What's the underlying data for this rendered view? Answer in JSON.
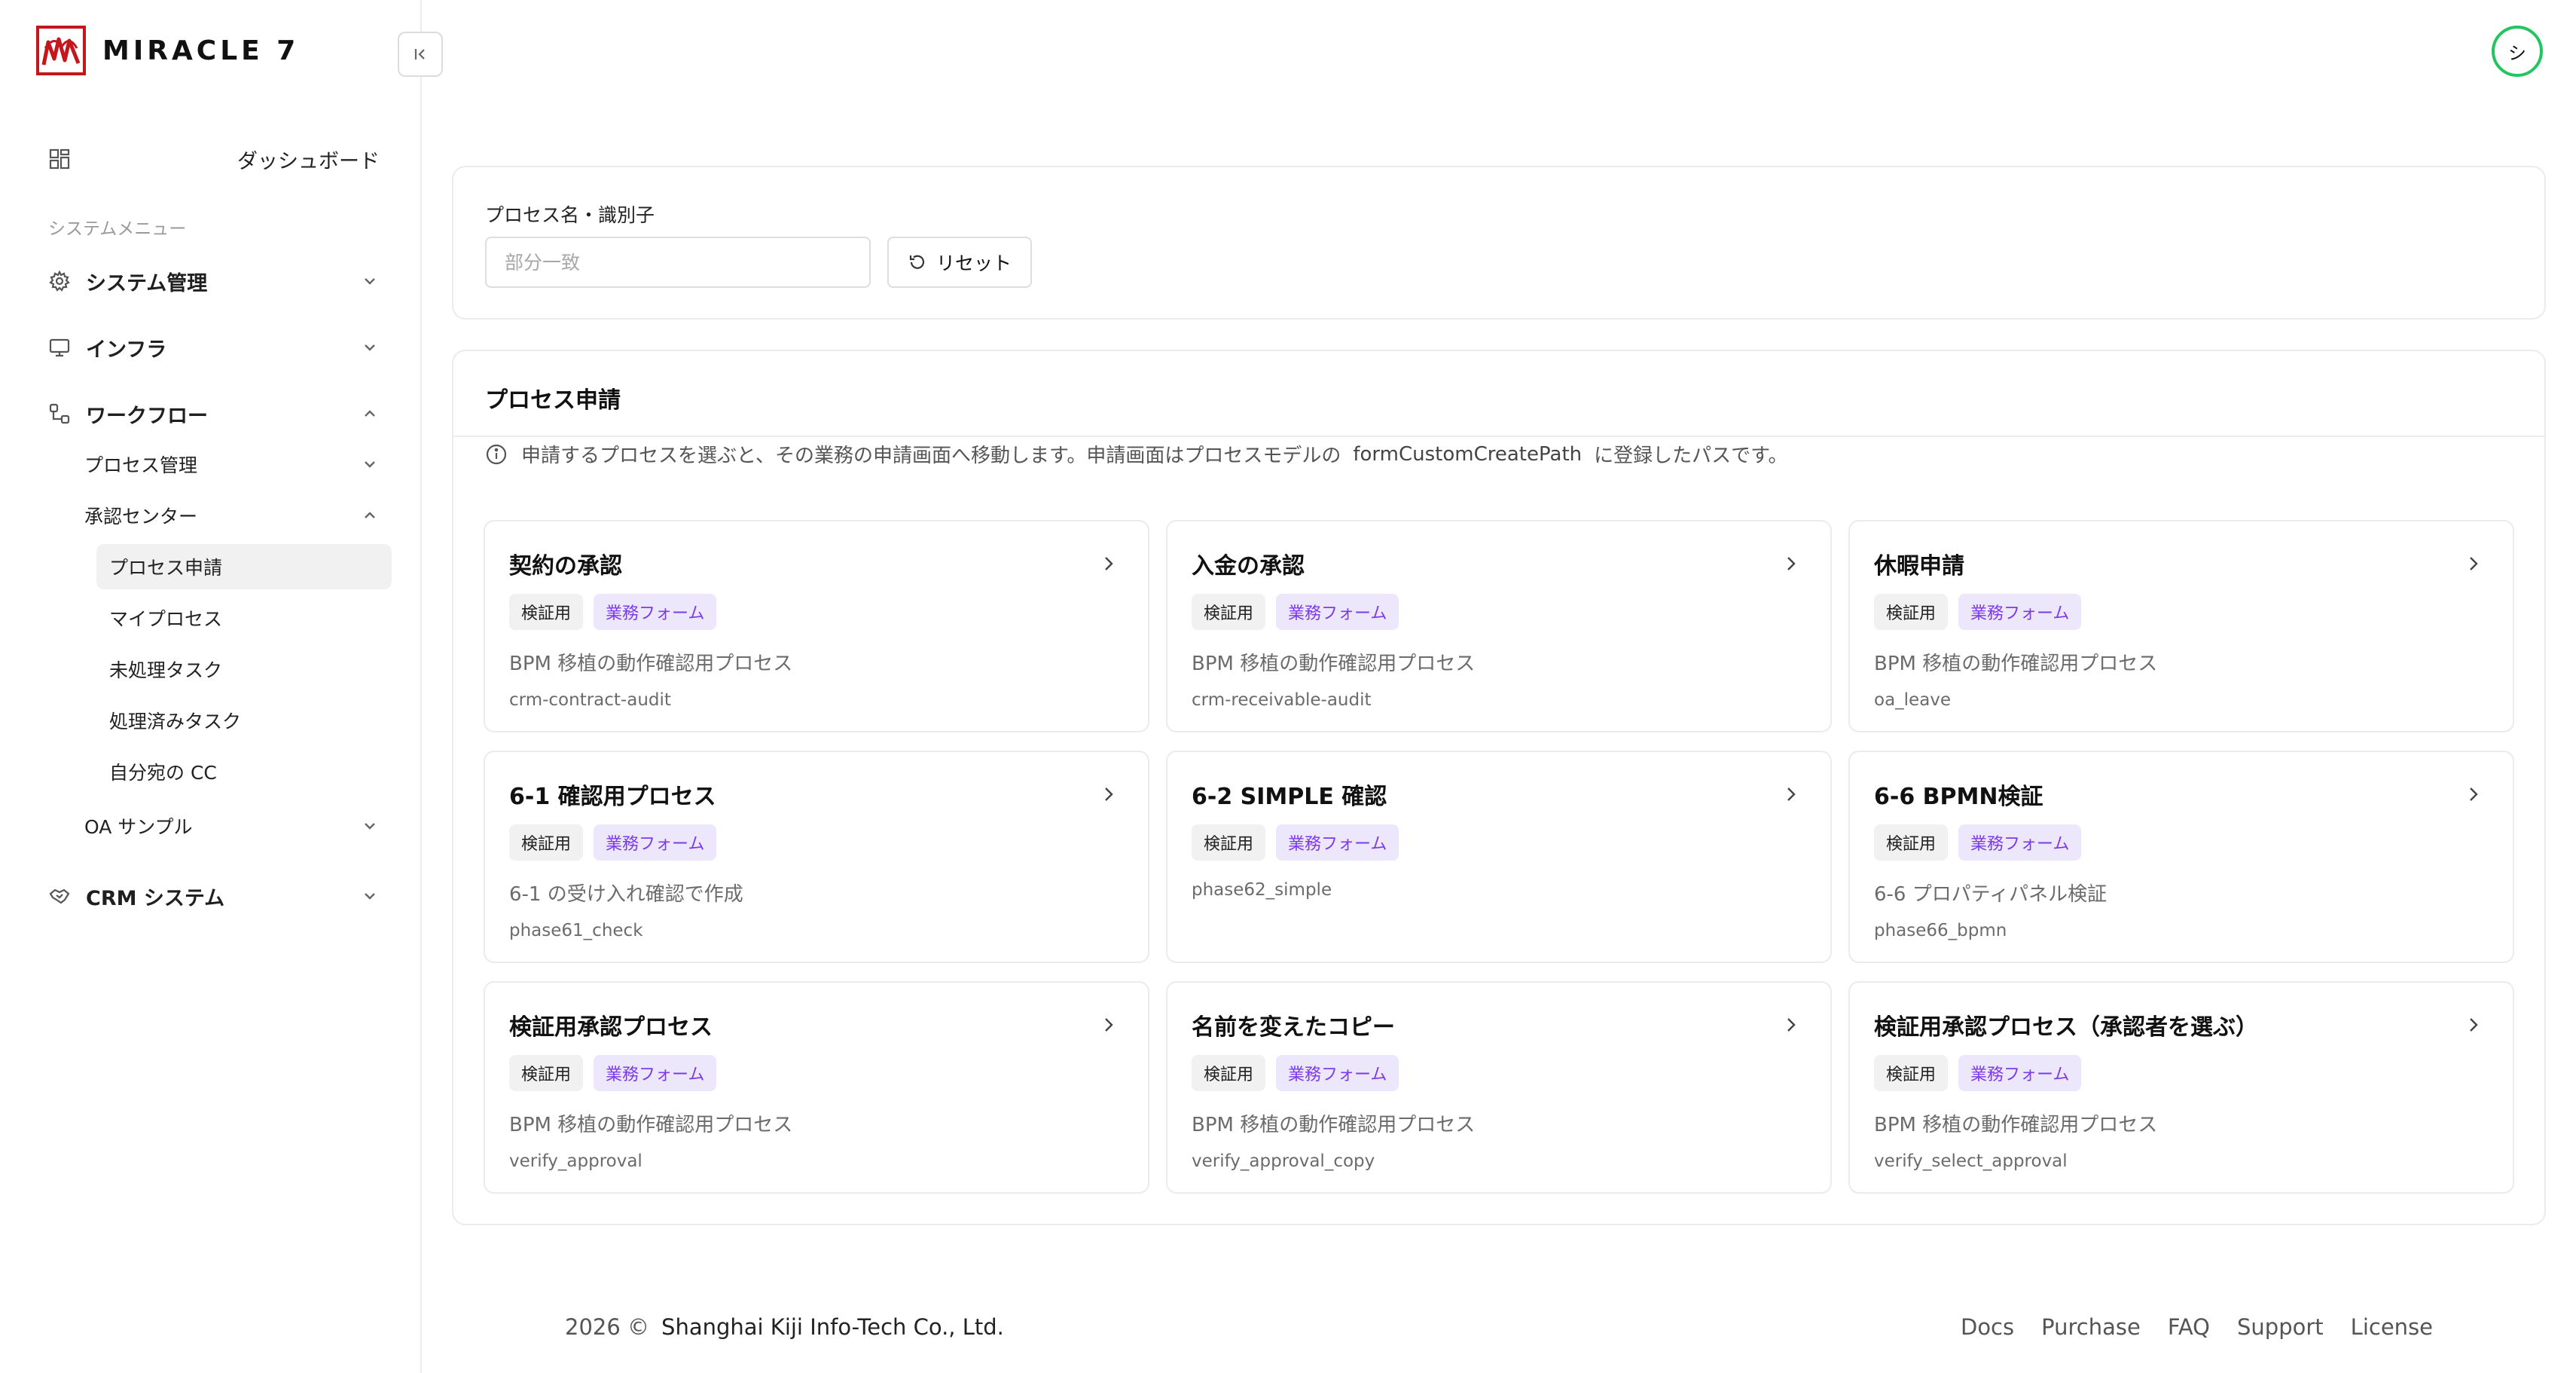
{
  "app": {
    "name": "MIRACLE 7"
  },
  "user": {
    "avatar_initial": "シ"
  },
  "sidebar": {
    "dashboard_label": "ダッシュボード",
    "section_label": "システムメニュー",
    "system_admin": "システム管理",
    "infra": "インフラ",
    "workflow": "ワークフロー",
    "process_admin": "プロセス管理",
    "approval_center": "承認センター",
    "approval_items": [
      "プロセス申請",
      "マイプロセス",
      "未処理タスク",
      "処理済みタスク",
      "自分宛の CC"
    ],
    "oa_sample": "OA サンプル",
    "crm": "CRM システム"
  },
  "search": {
    "label": "プロセス名・識別子",
    "placeholder": "部分一致",
    "value": "",
    "reset_label": "リセット"
  },
  "process": {
    "title": "プロセス申請",
    "hint_before": "申請するプロセスを選ぶと、その業務の申請画面へ移動します。申請画面はプロセスモデルの",
    "hint_code": "formCustomCreatePath",
    "hint_after": "に登録したパスです。",
    "tiles": [
      {
        "title": "契約の承認",
        "tags": [
          "検証用",
          "業務フォーム"
        ],
        "desc": "BPM 移植の動作確認用プロセス",
        "key": "crm-contract-audit"
      },
      {
        "title": "入金の承認",
        "tags": [
          "検証用",
          "業務フォーム"
        ],
        "desc": "BPM 移植の動作確認用プロセス",
        "key": "crm-receivable-audit"
      },
      {
        "title": "休暇申請",
        "tags": [
          "検証用",
          "業務フォーム"
        ],
        "desc": "BPM 移植の動作確認用プロセス",
        "key": "oa_leave"
      },
      {
        "title": "6-1 確認用プロセス",
        "tags": [
          "検証用",
          "業務フォーム"
        ],
        "desc": "6-1 の受け入れ確認で作成",
        "key": "phase61_check"
      },
      {
        "title": "6-2 SIMPLE 確認",
        "tags": [
          "検証用",
          "業務フォーム"
        ],
        "desc": "phase62_simple",
        "key": ""
      },
      {
        "title": "6-6 BPMN検証",
        "tags": [
          "検証用",
          "業務フォーム"
        ],
        "desc": "6-6 プロパティパネル検証",
        "key": "phase66_bpmn"
      },
      {
        "title": "検証用承認プロセス",
        "tags": [
          "検証用",
          "業務フォーム"
        ],
        "desc": "BPM 移植の動作確認用プロセス",
        "key": "verify_approval"
      },
      {
        "title": "名前を変えたコピー",
        "tags": [
          "検証用",
          "業務フォーム"
        ],
        "desc": "BPM 移植の動作確認用プロセス",
        "key": "verify_approval_copy"
      },
      {
        "title": "検証用承認プロセス（承認者を選ぶ）",
        "tags": [
          "検証用",
          "業務フォーム"
        ],
        "desc": "BPM 移植の動作確認用プロセス",
        "key": "verify_select_approval"
      }
    ]
  },
  "footer": {
    "copyright": "2026 ©",
    "company": "Shanghai Kiji Info-Tech Co., Ltd.",
    "links": [
      "Docs",
      "Purchase",
      "FAQ",
      "Support",
      "License"
    ]
  },
  "colors": {
    "accent_purple": "#7c3aed",
    "avatar_ring": "#22c55e",
    "brand_red": "#c4161c"
  }
}
